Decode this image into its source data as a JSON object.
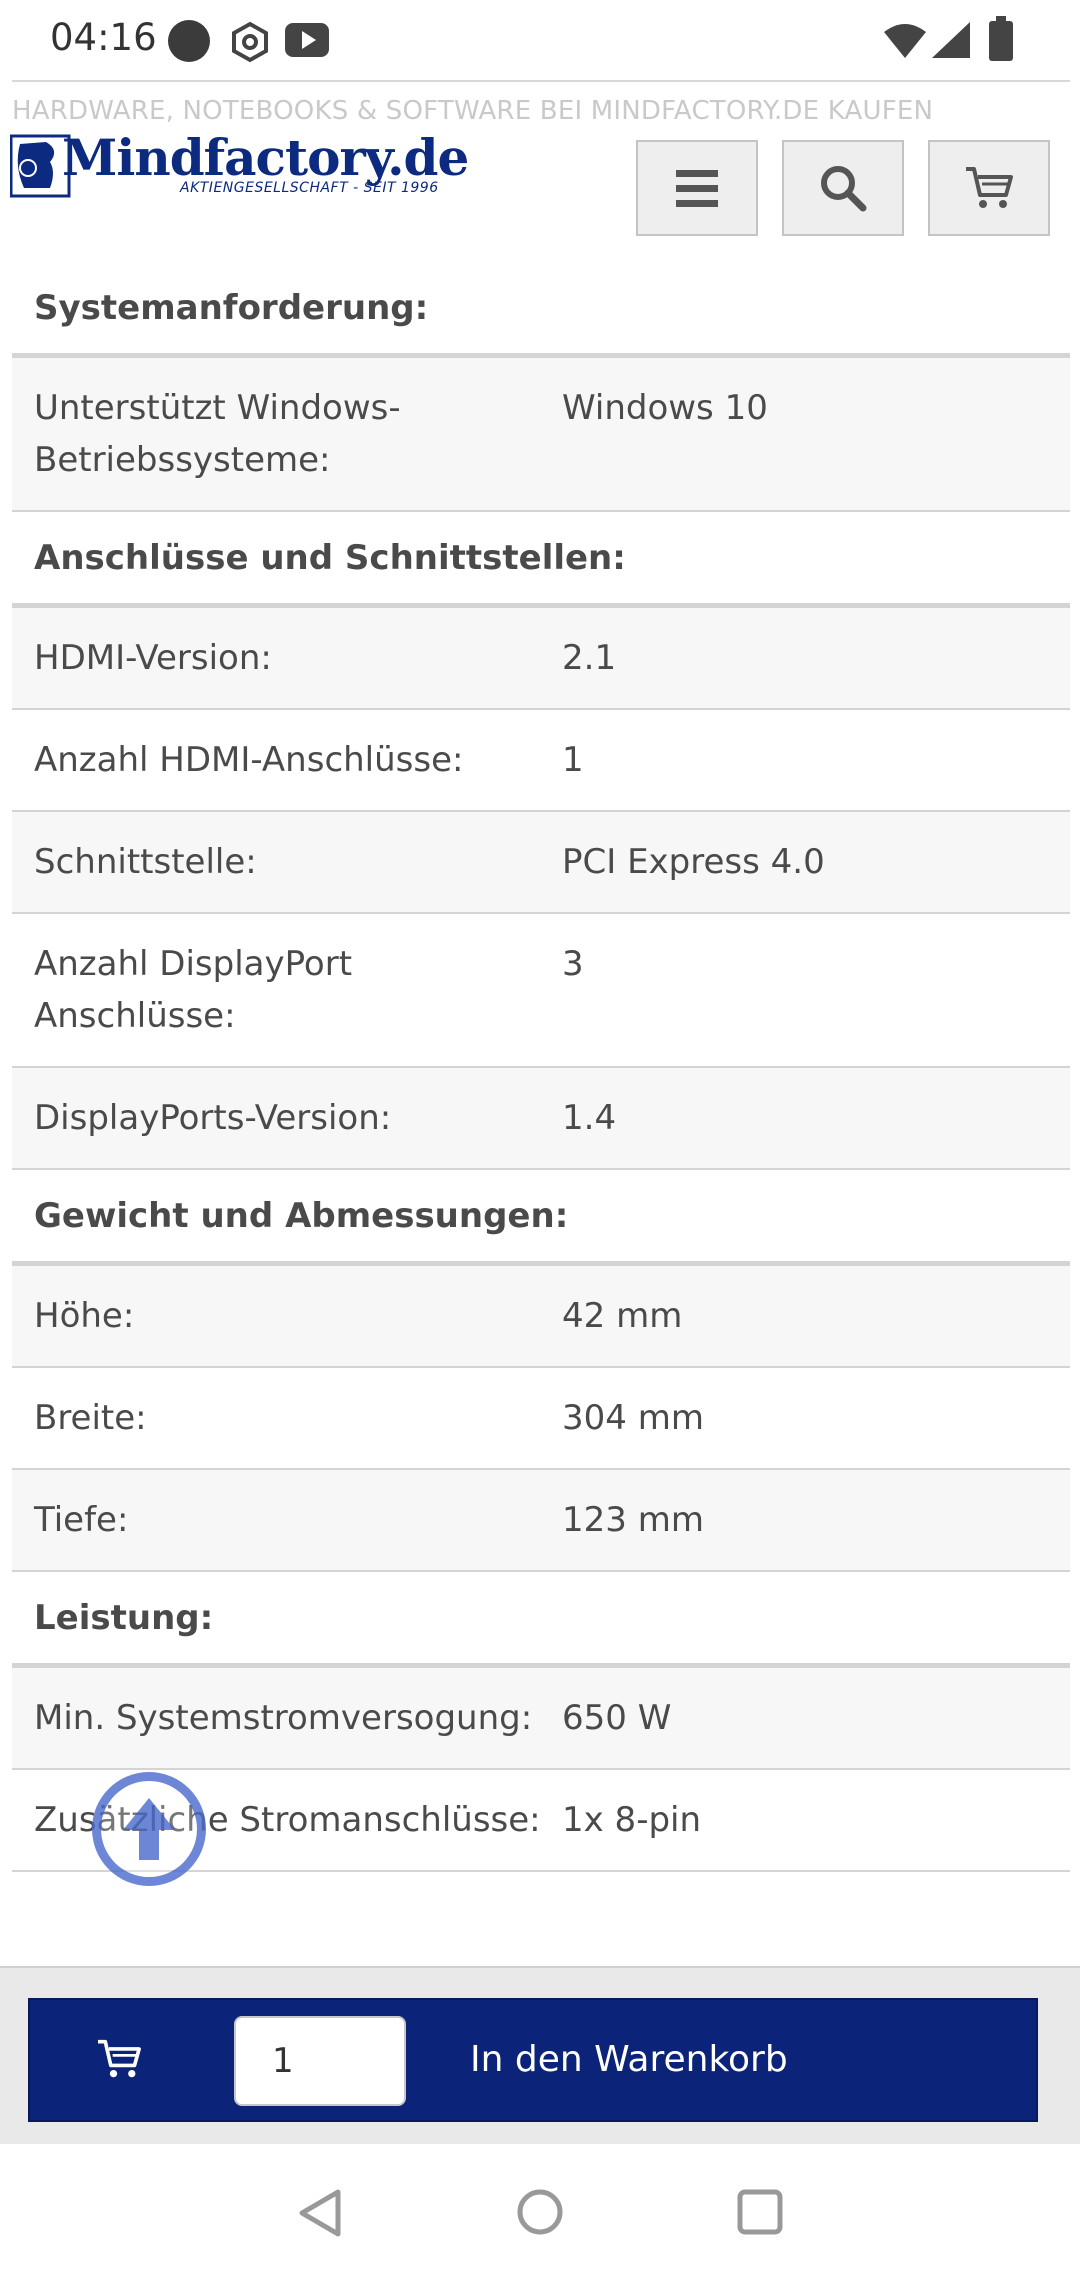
{
  "status_bar": {
    "time": "04:16",
    "icons": [
      "record-dot-icon",
      "hexagon-icon",
      "youtube-icon",
      "wifi-icon",
      "signal-icon",
      "battery-icon"
    ]
  },
  "header": {
    "tagline": "HARDWARE, NOTEBOOKS & SOFTWARE BEI MINDFACTORY.DE KAUFEN",
    "logo_text": "Mindfactory.de",
    "logo_subtitle": "AKTIENGESELLSCHAFT - SEIT 1996",
    "buttons": [
      "menu-icon",
      "search-icon",
      "cart-icon"
    ]
  },
  "specs": [
    {
      "type": "section",
      "title": "Systemanforderung:"
    },
    {
      "type": "row",
      "key": "Unterstützt Windows-Betriebssysteme:",
      "value": "Windows 10"
    },
    {
      "type": "section",
      "title": "Anschlüsse und Schnittstellen:"
    },
    {
      "type": "row",
      "key": "HDMI-Version:",
      "value": "2.1"
    },
    {
      "type": "row",
      "key": "Anzahl HDMI-Anschlüsse:",
      "value": "1"
    },
    {
      "type": "row",
      "key": "Schnittstelle:",
      "value": "PCI Express 4.0"
    },
    {
      "type": "row",
      "key": "Anzahl DisplayPort Anschlüsse:",
      "value": "3"
    },
    {
      "type": "row",
      "key": "DisplayPorts-Version:",
      "value": "1.4"
    },
    {
      "type": "section",
      "title": "Gewicht und Abmessungen:"
    },
    {
      "type": "row",
      "key": "Höhe:",
      "value": "42 mm"
    },
    {
      "type": "row",
      "key": "Breite:",
      "value": "304 mm"
    },
    {
      "type": "row",
      "key": "Tiefe:",
      "value": "123 mm"
    },
    {
      "type": "section",
      "title": "Leistung:"
    },
    {
      "type": "row",
      "key": "Min. Systemstromversogung:",
      "value": "650 W"
    },
    {
      "type": "row",
      "key": "Zusätzliche Stromanschlüsse:",
      "value": "1x 8-pin"
    }
  ],
  "cart_bar": {
    "quantity": "1",
    "label": "In den Warenkorb"
  },
  "colors": {
    "brand_blue": "#0b2479",
    "scroll_button": "#3c5fc8"
  }
}
